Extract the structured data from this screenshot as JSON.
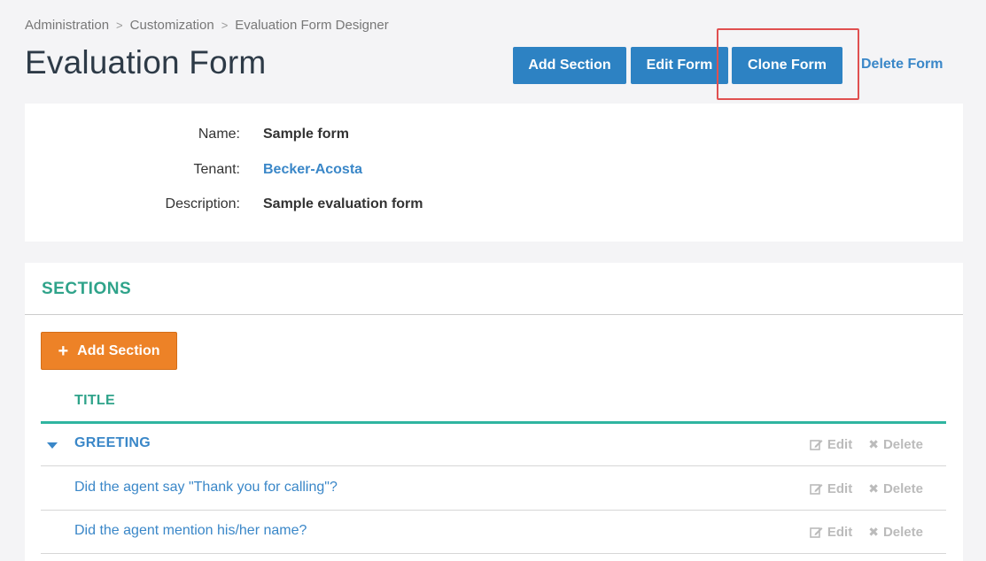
{
  "breadcrumb": {
    "items": [
      "Administration",
      "Customization",
      "Evaluation Form Designer"
    ],
    "separator": ">"
  },
  "page": {
    "title": "Evaluation Form"
  },
  "toolbar": {
    "add_section_label": "Add Section",
    "edit_form_label": "Edit Form",
    "clone_form_label": "Clone Form",
    "delete_form_label": "Delete Form"
  },
  "info": {
    "name_label": "Name:",
    "name_value": "Sample form",
    "tenant_label": "Tenant:",
    "tenant_value": "Becker-Acosta",
    "description_label": "Description:",
    "description_value": "Sample evaluation form"
  },
  "sections": {
    "title": "SECTIONS",
    "add_button_label": "Add Section",
    "column_title": "TITLE",
    "rows": [
      {
        "text": "GREETING",
        "edit": "Edit",
        "delete": "Delete"
      },
      {
        "text": "Did the agent say \"Thank you for calling\"?",
        "edit": "Edit",
        "delete": "Delete"
      },
      {
        "text": "Did the agent mention his/her name?",
        "edit": "Edit",
        "delete": "Delete"
      }
    ]
  },
  "colors": {
    "primary_blue": "#2d82c3",
    "link_blue": "#3a87c8",
    "teal": "#2fa38a",
    "orange": "#ed8227",
    "highlight_red": "#e05050"
  },
  "icons": {
    "edit": "edit-icon",
    "delete": "close-icon",
    "caret": "caret-down-icon",
    "plus": "plus-icon"
  }
}
